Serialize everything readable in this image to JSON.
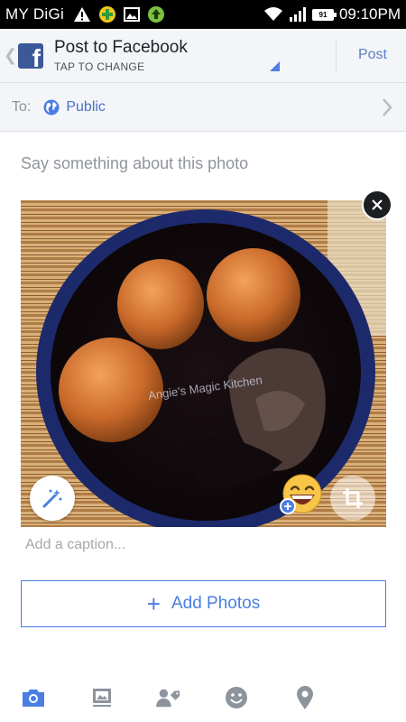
{
  "status_bar": {
    "carrier": "MY DiGi",
    "battery": "91",
    "time": "09:10PM"
  },
  "header": {
    "title": "Post to Facebook",
    "subtitle": "TAP TO CHANGE",
    "post_label": "Post"
  },
  "audience": {
    "to_label": "To:",
    "value": "Public"
  },
  "composer": {
    "prompt": "Say something about this photo",
    "caption_placeholder": "Add a caption...",
    "add_photos_label": "Add Photos",
    "add_photos_plus": "+"
  },
  "photo": {
    "watermark": "Angie's Magic Kitchen"
  },
  "toolbar": {
    "icons": [
      "camera-icon",
      "album-icon",
      "tag-people-icon",
      "feeling-icon",
      "location-icon"
    ],
    "active": "camera-icon"
  },
  "colors": {
    "accent": "#4a7ee3",
    "facebook_blue": "#3b5998",
    "header_bg": "#f4f5f8",
    "icon_gray": "#8d949e"
  }
}
